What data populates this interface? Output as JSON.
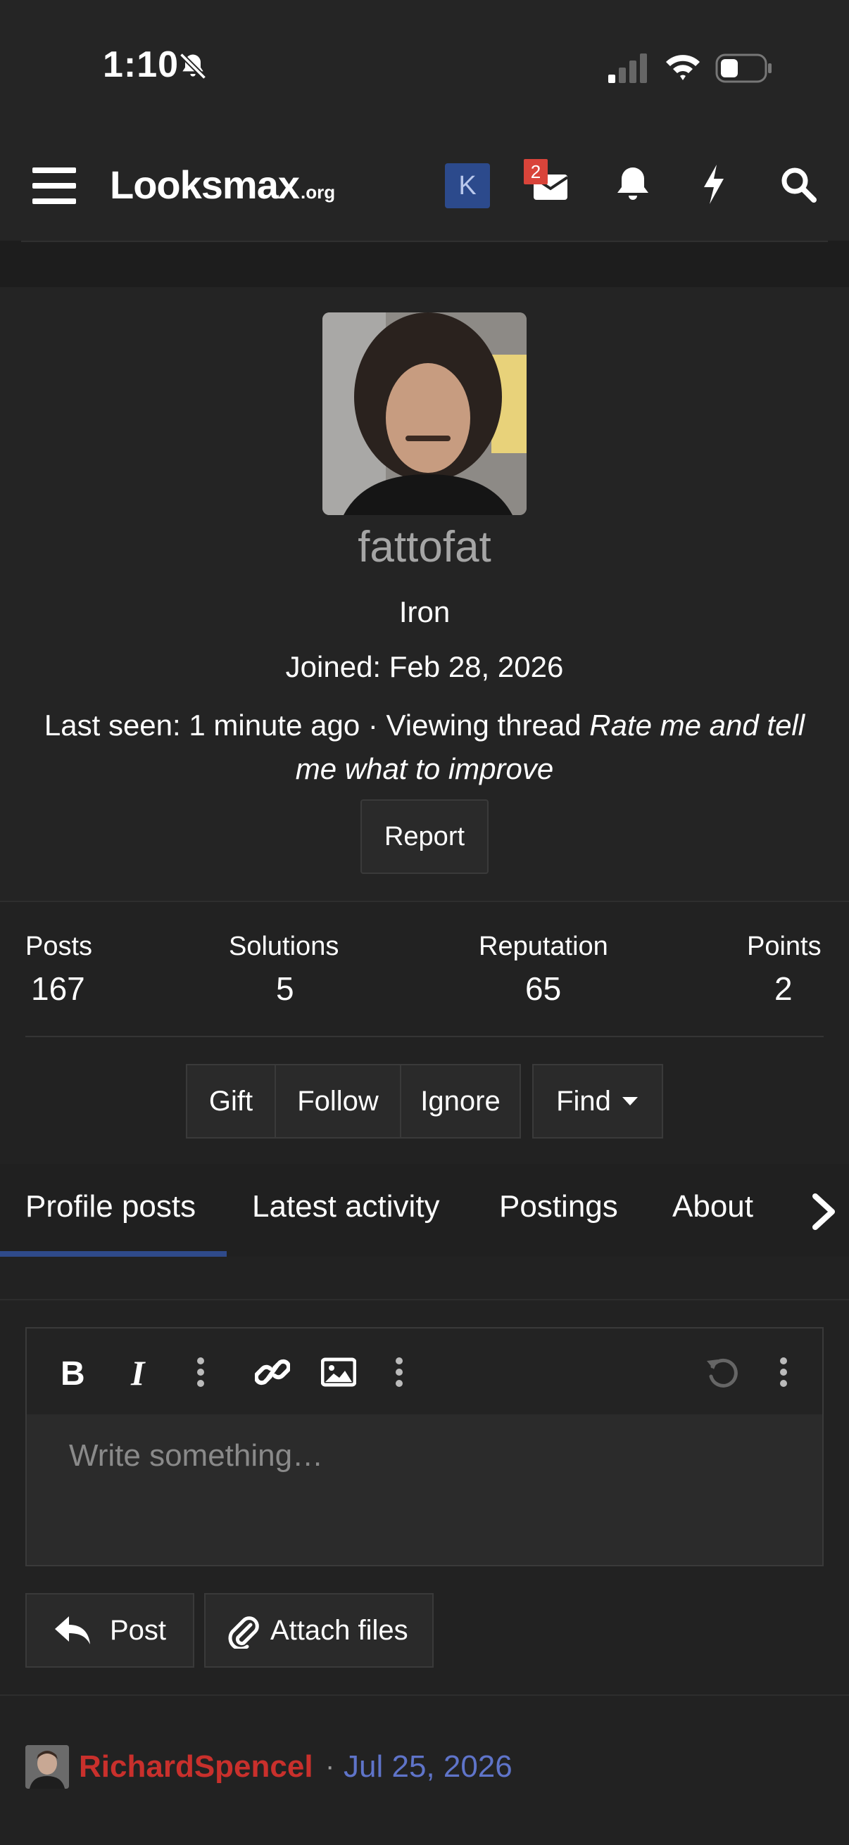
{
  "status_bar": {
    "time": "1:10"
  },
  "nav": {
    "logo_main": "Looksmax",
    "logo_tld": ".org",
    "user_initial": "K",
    "inbox_count": "2"
  },
  "profile": {
    "username": "fattofat",
    "title": "Iron",
    "joined": "Joined: Feb 28, 2026",
    "last_seen_prefix": "Last seen: 1 minute ago · Viewing thread ",
    "last_seen_thread": "Rate me and tell me what to improve",
    "report_label": "Report"
  },
  "stats": [
    {
      "label": "Posts",
      "value": "167"
    },
    {
      "label": "Solutions",
      "value": "5"
    },
    {
      "label": "Reputation",
      "value": "65"
    },
    {
      "label": "Points",
      "value": "2"
    }
  ],
  "actions": {
    "gift": "Gift",
    "follow": "Follow",
    "ignore": "Ignore",
    "find": "Find"
  },
  "tabs": [
    {
      "label": "Profile posts",
      "active": true
    },
    {
      "label": "Latest activity"
    },
    {
      "label": "Postings"
    },
    {
      "label": "About"
    }
  ],
  "editor": {
    "placeholder": "Write something…",
    "post_label": "Post",
    "attach_label": "Attach files"
  },
  "profile_post": {
    "author": "RichardSpencel",
    "separator": "·",
    "date": "Jul 25, 2026"
  },
  "colors": {
    "background": "#222222",
    "accent_blue": "#2f4a8a",
    "author_red": "#c9302c",
    "date_blue": "#5f74c9",
    "badge_red": "#d9443a"
  }
}
